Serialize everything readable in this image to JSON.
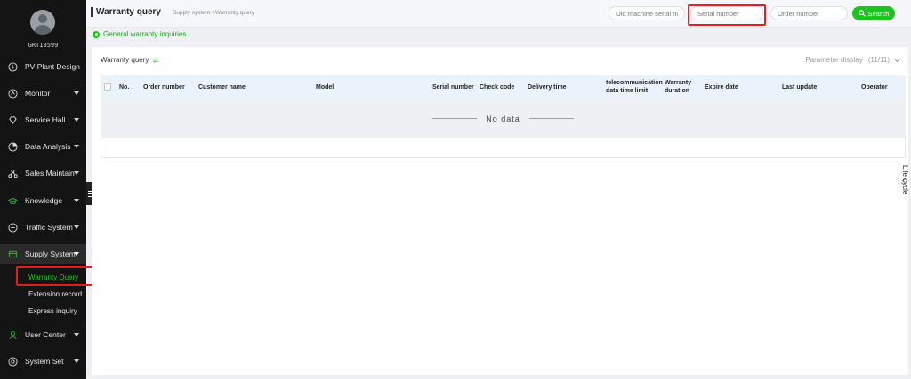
{
  "user": {
    "name": "GRT18599"
  },
  "sidebar": {
    "items": [
      {
        "label": "PV Plant Design",
        "icon": "lightning-icon",
        "caret": false
      },
      {
        "label": "Monitor",
        "icon": "monitor-icon",
        "caret": true
      },
      {
        "label": "Service Hall",
        "icon": "diamond-icon",
        "caret": true
      },
      {
        "label": "Data Analysis",
        "icon": "pie-chart-icon",
        "caret": true
      },
      {
        "label": "Sales Maintain",
        "icon": "network-icon",
        "caret": true
      },
      {
        "label": "Knowledge",
        "icon": "graduation-cap-icon",
        "caret": true
      },
      {
        "label": "Traffic System",
        "icon": "traffic-icon",
        "caret": true
      },
      {
        "label": "Supply System",
        "icon": "supply-icon",
        "caret": true
      },
      {
        "label": "User Center",
        "icon": "user-center-icon",
        "caret": true
      },
      {
        "label": "System Set",
        "icon": "settings-icon",
        "caret": true
      }
    ],
    "subitems": [
      {
        "label": "Warranty Query",
        "active": true
      },
      {
        "label": "Extension record",
        "active": false
      },
      {
        "label": "Express inquiry",
        "active": false
      }
    ]
  },
  "header": {
    "title": "Warranty query",
    "breadcrumb": "Supply system >Warranty query",
    "old_serial_placeholder": "Old machine serial nu",
    "serial_placeholder": "Serial number",
    "order_placeholder": "Order number",
    "search_label": "Search"
  },
  "general": {
    "label": "General warranty inquiries"
  },
  "panel": {
    "title": "Warranty query",
    "param_display": "Parameter display",
    "param_count": "(11/11)",
    "columns": [
      "No.",
      "Order number",
      "Customer name",
      "Model",
      "Serial number",
      "Check code",
      "Delivery time",
      "telecommunication data time limit",
      "Warranty duration",
      "Expire date",
      "Last update",
      "Operator"
    ],
    "no_data": "No data"
  },
  "lifecycle": {
    "label": "Life cycle"
  },
  "colors": {
    "accent": "#1ec41e",
    "highlight": "#e02020",
    "sidebar": "#141414"
  }
}
